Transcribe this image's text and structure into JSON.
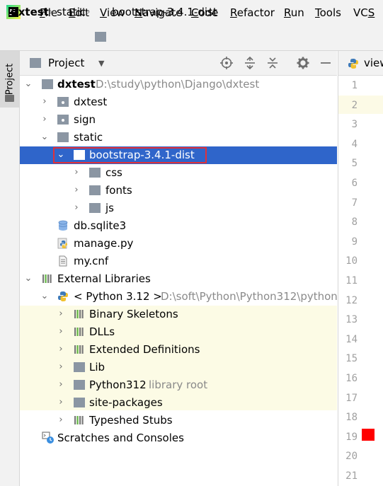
{
  "menu": {
    "items": [
      {
        "label": "File",
        "mnemonic": "F",
        "rest": "ile"
      },
      {
        "label": "Edit",
        "mnemonic": "E",
        "rest": "dit"
      },
      {
        "label": "View",
        "mnemonic": "V",
        "rest": "iew"
      },
      {
        "label": "Navigate",
        "mnemonic": "N",
        "rest": "avigate"
      },
      {
        "label": "Code",
        "mnemonic": "C",
        "rest": "ode"
      },
      {
        "label": "Refactor",
        "mnemonic": "R",
        "rest": "efactor"
      },
      {
        "label": "Run",
        "mnemonic": "R",
        "rest": "un"
      },
      {
        "label": "Tools",
        "mnemonic": "T",
        "rest": "ools"
      },
      {
        "label": "VCS",
        "mnemonic": "S",
        "rest": "VC"
      }
    ]
  },
  "breadcrumb": {
    "items": [
      "dxtest",
      "static",
      "bootstrap-3.4.1-dist"
    ],
    "separator": "›"
  },
  "toolstrip": {
    "project_label": "Project"
  },
  "project_panel": {
    "title": "Project",
    "tools": [
      "locate-icon",
      "expand-all-icon",
      "collapse-all-icon",
      "gear-icon",
      "minimize-icon"
    ]
  },
  "editor": {
    "tab_label": "view",
    "line_numbers": [
      "1",
      "2",
      "3",
      "4",
      "5",
      "6",
      "7",
      "8",
      "9",
      "10",
      "11",
      "12",
      "13",
      "14",
      "15",
      "16",
      "17",
      "18",
      "19",
      "20",
      "21"
    ],
    "highlighted_line": "2",
    "breakpoint_line": "19"
  },
  "tree": {
    "root": {
      "label": "dxtest",
      "path": "D:\\study\\python\\Django\\dxtest"
    },
    "dxtest_pkg": "dxtest",
    "sign": "sign",
    "static": "static",
    "bootstrap": "bootstrap-3.4.1-dist",
    "css": "css",
    "fonts": "fonts",
    "js": "js",
    "db": "db.sqlite3",
    "manage": "manage.py",
    "mycnf": "my.cnf",
    "ext_libs": "External Libraries",
    "python": {
      "label": "< Python 3.12 >",
      "path": "D:\\soft\\Python\\Python312\\python"
    },
    "binary_skeletons": "Binary Skeletons",
    "dlls": "DLLs",
    "extended_defs": "Extended Definitions",
    "lib": "Lib",
    "python312": {
      "label": "Python312",
      "hint": "library root"
    },
    "site_packages": "site-packages",
    "typeshed": "Typeshed Stubs",
    "scratches": "Scratches and Consoles"
  },
  "colors": {
    "selection": "#2f65ca",
    "library_bg": "#fcfbe5",
    "folder": "#8b96a3",
    "folder_selected": "#ffffff",
    "breakpoint": "#ff0000",
    "highlight_outline": "#e0313a"
  }
}
